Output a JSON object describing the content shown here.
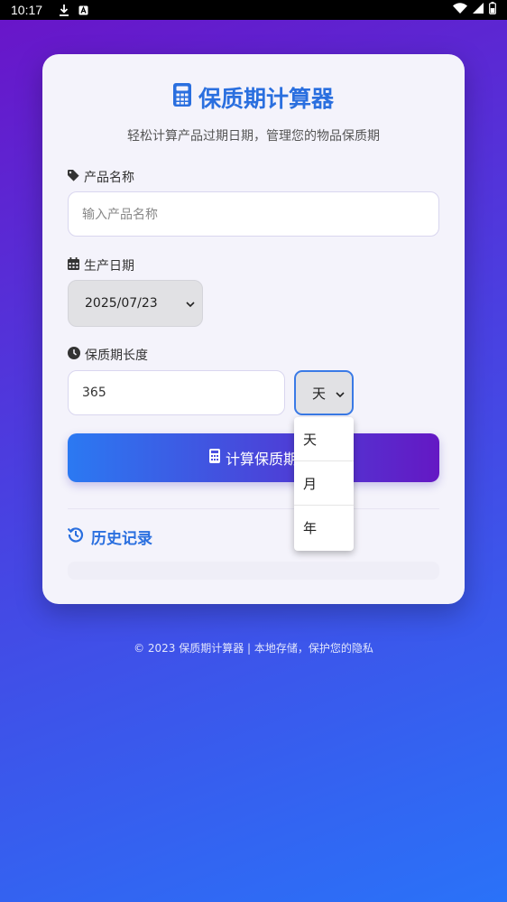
{
  "status_bar": {
    "time": "10:17"
  },
  "app": {
    "title": "保质期计算器",
    "subtitle": "轻松计算产品过期日期，管理您的物品保质期"
  },
  "form": {
    "product_name": {
      "label": "产品名称",
      "placeholder": "输入产品名称",
      "value": ""
    },
    "production_date": {
      "label": "生产日期",
      "value": "2025/07/23"
    },
    "shelf_life": {
      "label": "保质期长度",
      "value": "365",
      "unit_selected": "天"
    },
    "unit_options": [
      "天",
      "月",
      "年"
    ],
    "calculate_button": "计算保质期"
  },
  "history": {
    "title": "历史记录"
  },
  "footer": "© 2023 保质期计算器 | 本地存储，保护您的隐私",
  "colors": {
    "accent": "#2a6fdf",
    "gradient_start": "#2b79f2",
    "gradient_end": "#6418c4"
  }
}
